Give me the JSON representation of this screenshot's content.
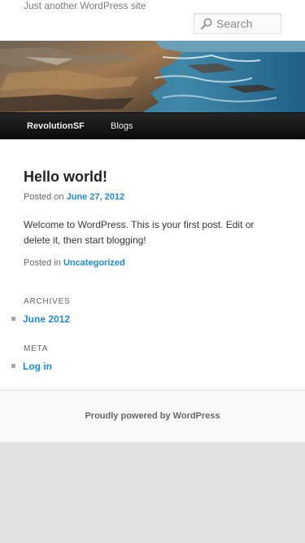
{
  "header": {
    "tagline": "Just another WordPress site",
    "search_placeholder": "Search"
  },
  "nav": {
    "items": [
      {
        "label": "RevolutionSF"
      },
      {
        "label": "Blogs"
      }
    ]
  },
  "post": {
    "title": "Hello world!",
    "posted_on_prefix": "Posted on",
    "date": "June 27, 2012",
    "body": "Welcome to WordPress. This is your first post. Edit or delete it, then start blogging!",
    "posted_in_prefix": "Posted in",
    "category": "Uncategorized"
  },
  "widgets": {
    "archives": {
      "title": "Archives",
      "items": [
        "June 2012"
      ]
    },
    "meta": {
      "title": "Meta",
      "items": [
        "Log in"
      ]
    }
  },
  "footer": {
    "powered_by": "Proudly powered by WordPress"
  },
  "colors": {
    "link": "#1b8be0",
    "nav_bg": "#111111",
    "background": "#e2e2e2"
  },
  "icons": {
    "search": "search-icon",
    "bullet": "square-bullet-icon"
  }
}
